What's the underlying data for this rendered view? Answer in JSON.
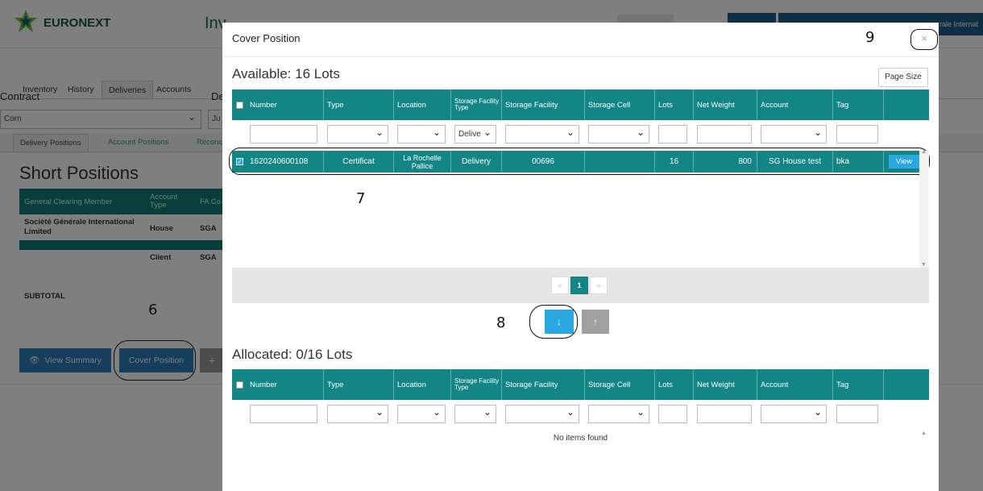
{
  "background": {
    "logo_text": "EURONEXT",
    "app_title": "Inv",
    "header_user": "rale Internat",
    "main_tabs": [
      "Inventory",
      "History",
      "Deliveries",
      "Accounts"
    ],
    "contract_label": "Contract",
    "contract_value": "Corn",
    "second_label": "De",
    "second_value": "Ju",
    "sub_tabs": [
      "Delivery Positions",
      "Account Positions",
      "Reconc"
    ],
    "short_positions_title": "Short Positions",
    "table_headers": [
      "General Clearing Member",
      "Account Type",
      "FA Co"
    ],
    "rows": [
      {
        "member": "Société Générale International Limited",
        "type": "House",
        "fa": "SGA"
      },
      {
        "member": "",
        "type": "Client",
        "fa": "SGA"
      }
    ],
    "subtotal": "SUBTOTAL",
    "view_summary_label": "View Summary",
    "cover_position_label": "Cover Position",
    "eye_icon": "eye-icon",
    "plus_icon": "plus-icon"
  },
  "annotations": {
    "a6": "6",
    "a7": "7",
    "a8": "8",
    "a9": "9"
  },
  "modal": {
    "title": "Cover Position",
    "close_glyph": "×",
    "page_size_label": "Page Size",
    "available": {
      "title": "Available: 16 Lots",
      "columns": [
        "Number",
        "Type",
        "Location",
        "Storage Facility Type",
        "Storage Facility",
        "Storage Cell",
        "Lots",
        "Net Weight",
        "Account",
        "Tag"
      ],
      "filter_values": {
        "storage_facility_type": "Delive"
      },
      "rows": [
        {
          "number": "1620240600108",
          "type": "Certificat",
          "location": "La Rochelle Pallice",
          "storage_facility_type": "Delivery",
          "storage_facility": "00696",
          "storage_cell": "",
          "lots": "16",
          "net_weight": "800",
          "account": "SG House test",
          "tag": "bka",
          "action": "View",
          "selected": true
        }
      ],
      "pager": {
        "prev": "«",
        "current": "1",
        "next": "»"
      }
    },
    "move_down_glyph": "↓",
    "move_up_glyph": "↑",
    "allocated": {
      "title": "Allocated: 0/16 Lots",
      "columns": [
        "Number",
        "Type",
        "Location",
        "Storage Facility Type",
        "Storage Facility",
        "Storage Cell",
        "Lots",
        "Net Weight",
        "Account",
        "Tag"
      ],
      "empty_text": "No items found"
    },
    "colors": {
      "header": "#138585",
      "accent": "#2aa6e0"
    }
  }
}
